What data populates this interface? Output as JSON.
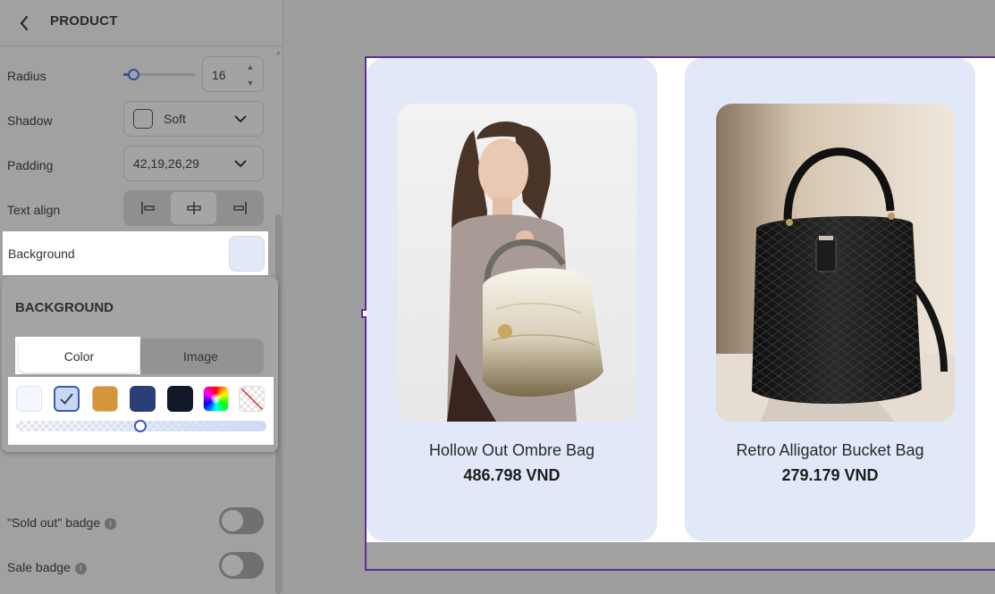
{
  "header": {
    "title": "PRODUCT",
    "back_icon": "chevron-left-icon"
  },
  "settings": {
    "radius": {
      "label": "Radius",
      "value": "16",
      "slider_fraction": 0.14
    },
    "shadow": {
      "label": "Shadow",
      "value": "Soft"
    },
    "padding": {
      "label": "Padding",
      "value": "42,19,26,29"
    },
    "text_align": {
      "label": "Text align",
      "options": [
        "align-left",
        "align-center",
        "align-right"
      ],
      "selected": "align-center"
    },
    "background": {
      "label": "Background",
      "color": "#e1e9f8"
    },
    "sold_out_badge": {
      "label": "\"Sold out\" badge",
      "enabled": false
    },
    "sale_badge": {
      "label": "Sale badge",
      "enabled": false
    }
  },
  "background_popover": {
    "title": "BACKGROUND",
    "tabs": [
      "Color",
      "Image"
    ],
    "active_tab": "Color",
    "swatches": [
      "#f4f7fd",
      "#c9d7f3",
      "#d4963a",
      "#2c3e7a",
      "#111827",
      "rainbow",
      "transparent"
    ],
    "selected_swatch": 1,
    "opacity_fraction": 0.5
  },
  "products": [
    {
      "name": "Hollow Out Ombre Bag",
      "price": "486.798 VND"
    },
    {
      "name": "Retro Alligator Bucket Bag",
      "price": "279.179 VND"
    }
  ],
  "colors": {
    "accent": "#5b2f9c",
    "card_bg": "#e1e9f8",
    "slider": "#2f4fa0"
  }
}
